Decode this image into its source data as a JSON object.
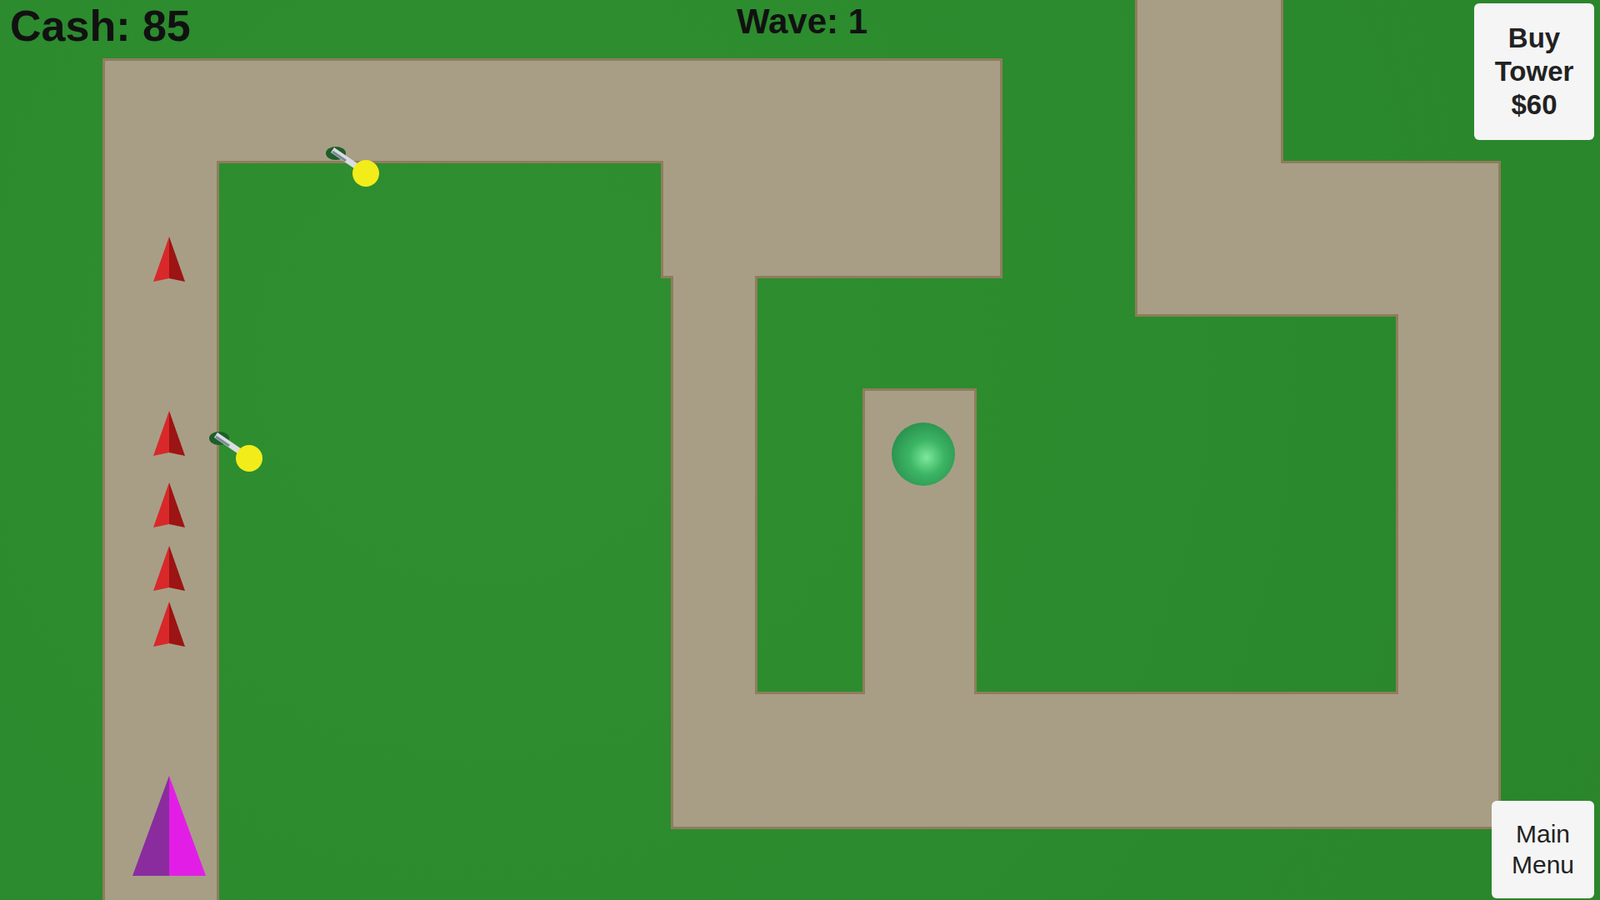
{
  "hud": {
    "cash": "Cash: 85",
    "wave": "Wave: 1"
  },
  "buttons": [
    {
      "label": "Buy Tower $60",
      "kind": "buy"
    },
    {
      "label": "Main Menu",
      "kind": "menu"
    }
  ]
}
